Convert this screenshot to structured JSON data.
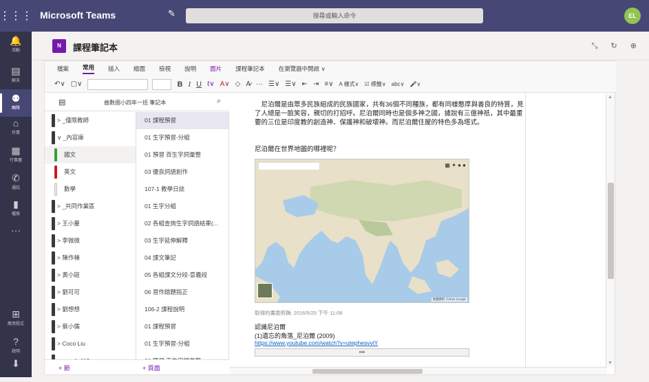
{
  "app": {
    "title": "Microsoft Teams",
    "waffle_icon": "⋮⋮⋮",
    "compose_icon": "✎",
    "search_placeholder": "搜尋或輸入命令",
    "avatar_initials": "EL"
  },
  "rail": [
    {
      "icon": "bell-icon",
      "glyph": "🔔",
      "label": "活動"
    },
    {
      "icon": "chat-icon",
      "glyph": "▤",
      "label": "聊天"
    },
    {
      "icon": "teams-icon",
      "glyph": "⚉",
      "label": "團隊",
      "active": true
    },
    {
      "icon": "assignments-icon",
      "glyph": "⌂",
      "label": "作業"
    },
    {
      "icon": "calendar-icon",
      "glyph": "▦",
      "label": "行事曆"
    },
    {
      "icon": "calls-icon",
      "glyph": "✆",
      "label": "通話"
    },
    {
      "icon": "files-icon",
      "glyph": "▮",
      "label": "檔案"
    },
    {
      "icon": "more-icon",
      "glyph": "···",
      "label": ""
    },
    {
      "icon": "apps-icon",
      "glyph": "⊞",
      "label": "應用程式"
    },
    {
      "icon": "help-icon",
      "glyph": "?",
      "label": "說明"
    },
    {
      "icon": "download-icon",
      "glyph": "⬇",
      "label": ""
    }
  ],
  "channel": {
    "tab_title": "課程筆記本",
    "logo_text": "N",
    "header_icons": "⤡ ↻ ⊕"
  },
  "ribbon": {
    "tabs": [
      "檔案",
      "常用",
      "插入",
      "繪圖",
      "檢視",
      "說明",
      "圖片",
      "課程筆記本",
      "在瀏覽器中開啟 ∨"
    ],
    "active_tab": "常用",
    "undo": "↶∨",
    "clipboard": "▢∨",
    "bold": "B",
    "italic": "I",
    "underline": "U",
    "highlight": "ℓ∨",
    "fontcolor": "A∨",
    "eraser": "◇",
    "clear": "A̷",
    "more": "···",
    "bullets": "☰∨",
    "numbering": "☰∨",
    "outdent": "⇤",
    "indent": "⇥",
    "align": "≡∨",
    "styles": "A 樣式∨",
    "tags": "☑ 標籤∨",
    "spell": "abc∨",
    "dictate": "🎤∨"
  },
  "notebook": {
    "name": "齒數國小四年一班 筆記本",
    "notebook_icon": "▤",
    "search_icon": "⌕"
  },
  "sections": [
    {
      "label": "> _僅限教師",
      "type": "group"
    },
    {
      "label": "∨ _內容庫",
      "type": "group"
    },
    {
      "label": "國文",
      "type": "child",
      "color": "#33a031",
      "selected": true
    },
    {
      "label": "英文",
      "type": "child",
      "color": "#c81d24"
    },
    {
      "label": "數學",
      "type": "child",
      "color": "#e8e6e4"
    },
    {
      "label": "> _共同作業區",
      "type": "group"
    },
    {
      "label": "> 王小蔓",
      "type": "group"
    },
    {
      "label": "> 李微微",
      "type": "group"
    },
    {
      "label": "> 陳作棟",
      "type": "group"
    },
    {
      "label": "> 黃小庭",
      "type": "group"
    },
    {
      "label": "> 劉可可",
      "type": "group"
    },
    {
      "label": "> 劉想想",
      "type": "group"
    },
    {
      "label": "> 蔡小儒",
      "type": "group"
    },
    {
      "label": "> Coco Liu",
      "type": "group"
    },
    {
      "label": "> cocoliu112",
      "type": "group"
    }
  ],
  "pages": [
    {
      "label": "01 課程預習",
      "selected": true
    },
    {
      "label": "01 生字預習-分組"
    },
    {
      "label": "01 預習 百生字詞彙整"
    },
    {
      "label": "03 優良詞語創作"
    },
    {
      "label": "107-1 教學日誌"
    },
    {
      "label": "01 生字分組"
    },
    {
      "label": "02 各組查詢生字詞語結果(..."
    },
    {
      "label": "03 生字延伸解釋"
    },
    {
      "label": "04 課文筆記"
    },
    {
      "label": "05 各組課文分段-意義段"
    },
    {
      "label": "06 習作錯題指正"
    },
    {
      "label": "106-2 課程說明"
    },
    {
      "label": "01 課程預習"
    },
    {
      "label": "01 生字預習-分組"
    },
    {
      "label": "01 預習 百生字詞彙整"
    }
  ],
  "addbar": {
    "add_section": "+ 節",
    "add_page": "+ 頁面"
  },
  "page": {
    "paragraph": "　尼泊爾是由眾多民族組成的民族國家，共有36個不同種族，都有同樣憨厚與善良的特質，見了人總是一臉笑容，親切的打招呼。尼泊爾同時也是個多神之國，據說有三億神祇，其中最重要的三位是印度教的創造神、保護神和破壞神。而尼泊爾住屋的特色多為塔式。",
    "question": "尼泊爾在世界地圖的哪裡呢？",
    "map_search": "",
    "map_controls": "▦ ✦ ● ●",
    "map_footer": "地圖資料 ©2016 Google",
    "retrieved": "取得的畫面剪輯: 2016/5/25 下午 11:08",
    "ref_title": "認識尼泊爾",
    "ref_item": "(1)遺忘的角落_尼泊爾 (2009)",
    "ref_link": "https://www.youtube.com/watch?v=utephesvviY",
    "embed_more": "•••"
  }
}
